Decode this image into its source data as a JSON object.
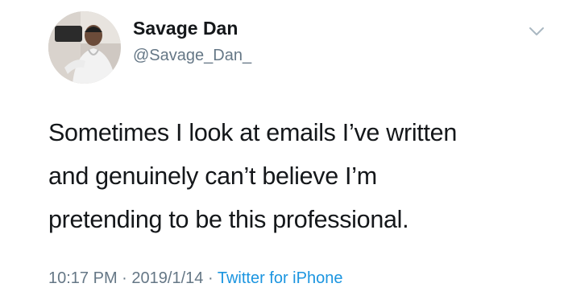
{
  "tweet": {
    "author": {
      "display_name": "Savage Dan",
      "handle": "@Savage_Dan_",
      "avatar": "avatar-photo"
    },
    "text_lines": [
      "Sometimes I look at emails I’ve written",
      "and genuinely can’t believe I’m",
      "pretending to be this professional."
    ],
    "time": "10:17 PM",
    "separator": "·",
    "date": "2019/1/14",
    "source": "Twitter for iPhone",
    "menu_icon": "chevron-down-icon",
    "colors": {
      "text": "#14171a",
      "secondary": "#657786",
      "link": "#1b95e0"
    }
  }
}
